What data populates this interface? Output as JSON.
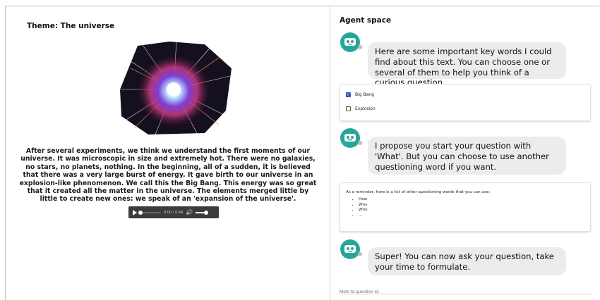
{
  "left": {
    "theme": "Theme: The universe",
    "story": "After several experiments, we think we understand the first moments of our universe. It was microscopic in size and extremely hot. There were no galaxies, no stars, no planets, nothing. In the beginning, all of a sudden, it is believed that there was a very large burst of energy. It gave birth to our universe in an explosion-like phenomenon. We call this the Big Bang. This energy was so great that it created all the matter in the universe. The elements merged little by little to create new ones: we speak of an 'expansion of the universe'.",
    "audio": {
      "time": "0:00 / 0:44",
      "progress": 0.0
    }
  },
  "right": {
    "title": "Agent space",
    "messages": [
      {
        "text": "Here are some important key words I could find about this text. You can choose one or several of them to help you think of a curious question."
      },
      {
        "text": "I propose you start your question with 'What'. But you can choose to use another questioning word if you want."
      },
      {
        "text": "Super! You can now ask your question, take your time to formulate."
      }
    ],
    "keywords": [
      {
        "label": "Big Bang",
        "checked": true
      },
      {
        "label": "Explosion",
        "checked": false
      }
    ],
    "reminder": {
      "intro": "As a reminder, here is a list of other questioning words that you can use:",
      "items": [
        "How",
        "Why",
        "Who",
        "..."
      ]
    },
    "input_placeholder": "Mets ta question ici"
  },
  "colors": {
    "accent": "#3f51b5",
    "bubble": "#ececec",
    "avatar": "#26a69a"
  }
}
